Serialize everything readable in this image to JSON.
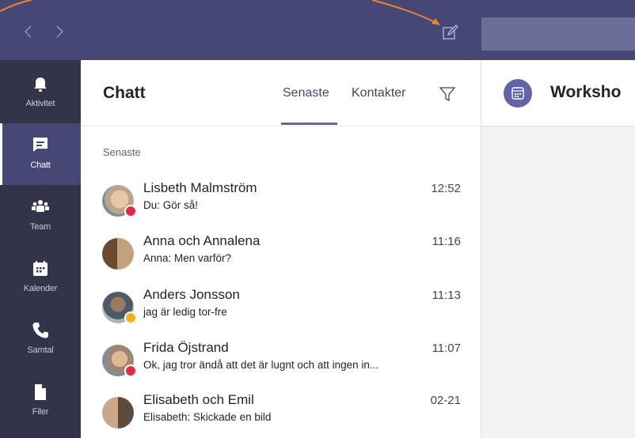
{
  "colors": {
    "topbar": "#464775",
    "rail": "#33344a",
    "rail_active": "#464775",
    "accent": "#6264a7",
    "status_busy": "#e02a4f",
    "status_away": "#f6b01e",
    "callout": "#e8862a"
  },
  "topbar": {
    "back_icon": "chevron-left-icon",
    "forward_icon": "chevron-right-icon",
    "compose_icon": "compose-icon"
  },
  "rail": {
    "items": [
      {
        "label": "Aktivitet",
        "icon": "bell-icon",
        "active": false
      },
      {
        "label": "Chatt",
        "icon": "chat-icon",
        "active": true
      },
      {
        "label": "Team",
        "icon": "team-icon",
        "active": false
      },
      {
        "label": "Kalender",
        "icon": "calendar-icon",
        "active": false
      },
      {
        "label": "Samtal",
        "icon": "phone-icon",
        "active": false
      },
      {
        "label": "Filer",
        "icon": "file-icon",
        "active": false
      }
    ]
  },
  "chat": {
    "title": "Chatt",
    "tabs": {
      "recent": "Senaste",
      "contacts": "Kontakter"
    },
    "filter_icon": "filter-icon",
    "section_label": "Senaste",
    "rows": [
      {
        "name": "Lisbeth Malmström",
        "time": "12:52",
        "preview": "Du: Gör så!",
        "status": "busy"
      },
      {
        "name": "Anna och Annalena",
        "time": "11:16",
        "preview": "Anna: Men varför?",
        "status": "none"
      },
      {
        "name": "Anders Jonsson",
        "time": "11:13",
        "preview": "jag är ledig tor-fre",
        "status": "away"
      },
      {
        "name": "Frida Öjstrand",
        "time": "11:07",
        "preview": "Ok, jag tror ändå att det är lugnt och att ingen in...",
        "status": "busy"
      },
      {
        "name": "Elisabeth och Emil",
        "time": "02-21",
        "preview": "Elisabeth: Skickade en bild",
        "status": "none"
      }
    ]
  },
  "right": {
    "title": "Worksho",
    "icon": "meeting-calendar-icon"
  }
}
